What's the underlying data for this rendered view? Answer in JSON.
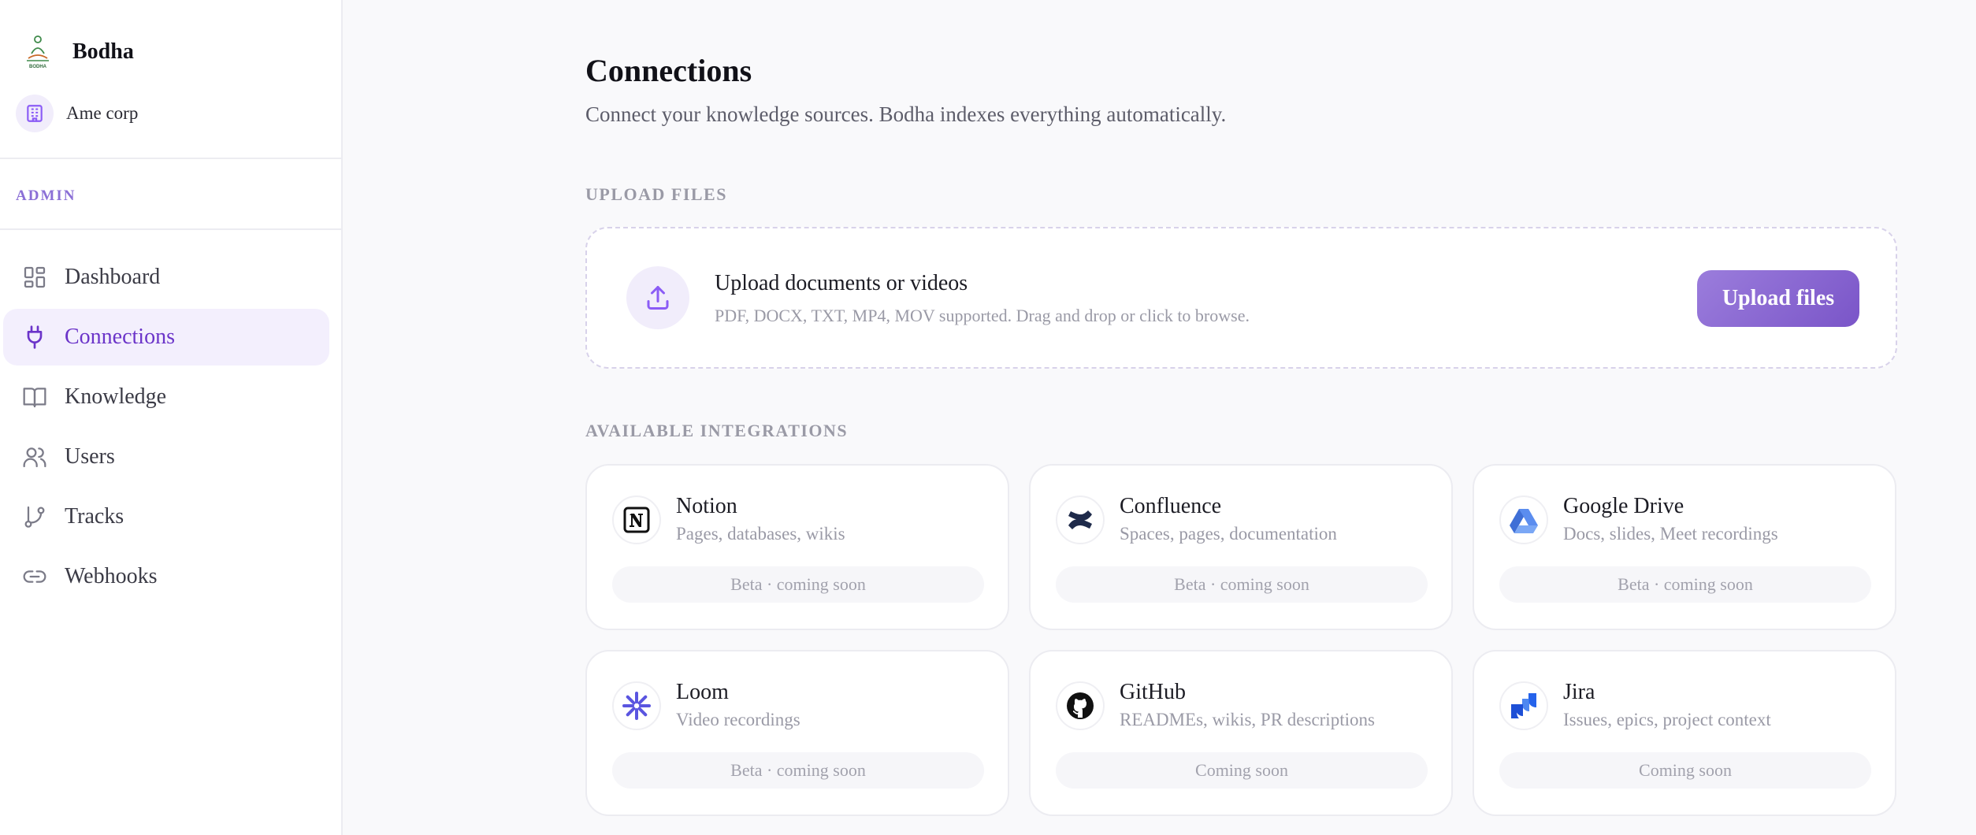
{
  "brand": {
    "name": "Bodha",
    "logo_text": "BODHA"
  },
  "org": {
    "name": "Ame corp",
    "icon": "building-icon"
  },
  "sidebar": {
    "section_label": "ADMIN",
    "items": [
      {
        "label": "Dashboard",
        "icon": "dashboard-icon",
        "active": false
      },
      {
        "label": "Connections",
        "icon": "plug-icon",
        "active": true
      },
      {
        "label": "Knowledge",
        "icon": "book-icon",
        "active": false
      },
      {
        "label": "Users",
        "icon": "users-icon",
        "active": false
      },
      {
        "label": "Tracks",
        "icon": "git-branch-icon",
        "active": false
      },
      {
        "label": "Webhooks",
        "icon": "link-icon",
        "active": false
      }
    ]
  },
  "main": {
    "title": "Connections",
    "subtitle": "Connect your knowledge sources. Bodha indexes everything automatically.",
    "upload_section_label": "UPLOAD FILES",
    "upload": {
      "icon": "upload-icon",
      "title": "Upload documents or videos",
      "description": "PDF, DOCX, TXT, MP4, MOV supported. Drag and drop or click to browse.",
      "button_label": "Upload files"
    },
    "integrations_label": "AVAILABLE INTEGRATIONS",
    "integrations": [
      {
        "name": "Notion",
        "description": "Pages, databases, wikis",
        "status": "Beta · coming soon",
        "icon": "notion-icon"
      },
      {
        "name": "Confluence",
        "description": "Spaces, pages, documentation",
        "status": "Beta · coming soon",
        "icon": "confluence-icon"
      },
      {
        "name": "Google Drive",
        "description": "Docs, slides, Meet recordings",
        "status": "Beta · coming soon",
        "icon": "google-drive-icon"
      },
      {
        "name": "Loom",
        "description": "Video recordings",
        "status": "Beta · coming soon",
        "icon": "loom-icon"
      },
      {
        "name": "GitHub",
        "description": "READMEs, wikis, PR descriptions",
        "status": "Coming soon",
        "icon": "github-icon"
      },
      {
        "name": "Jira",
        "description": "Issues, epics, project context",
        "status": "Coming soon",
        "icon": "jira-icon"
      }
    ]
  },
  "colors": {
    "accent": "#6b34c9",
    "accent_soft": "#f3effd",
    "button_gradient_start": "#9b7ddc",
    "button_gradient_end": "#7a55c8",
    "background": "#f9f9fb"
  }
}
